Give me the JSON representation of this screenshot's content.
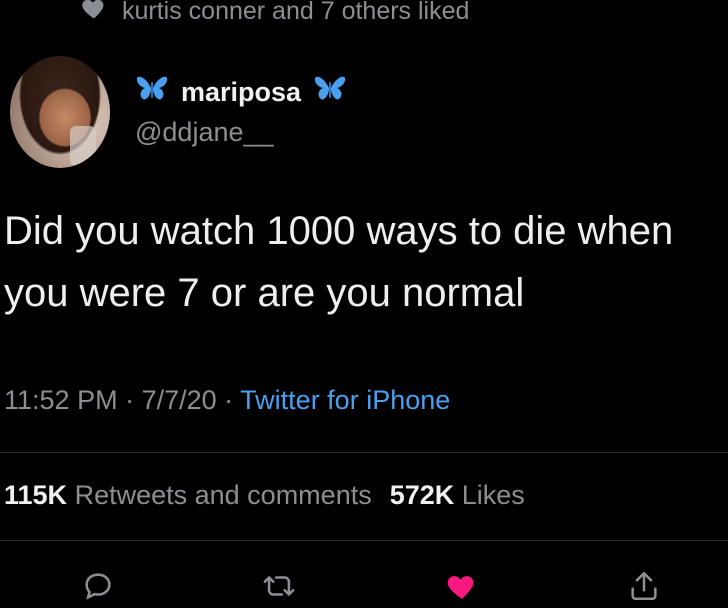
{
  "liked_by": {
    "text": "kurtis conner and 7 others liked",
    "icon": "heart-icon"
  },
  "author": {
    "display_name": "mariposa",
    "handle": "@ddjane__",
    "emoji": "butterfly-icon",
    "emoji_color": "#4aa0ee"
  },
  "tweet": {
    "line1": "Did you watch 1000 ways to die when",
    "line2": "you were 7 or are you normal"
  },
  "meta": {
    "time": "11:52 PM",
    "date": "7/7/20",
    "separator": " · ",
    "source": "Twitter for iPhone"
  },
  "stats": {
    "retweets_count": "115K",
    "retweets_label": "Retweets and comments",
    "likes_count": "572K",
    "likes_label": "Likes"
  },
  "actions": {
    "reply_icon": "reply-icon",
    "retweet_icon": "retweet-icon",
    "like_icon": "heart-filled-icon",
    "share_icon": "share-icon",
    "like_color": "#f91880"
  },
  "colors": {
    "background": "#000000",
    "secondary_text": "#8b8f94",
    "link": "#4aa0ee"
  }
}
